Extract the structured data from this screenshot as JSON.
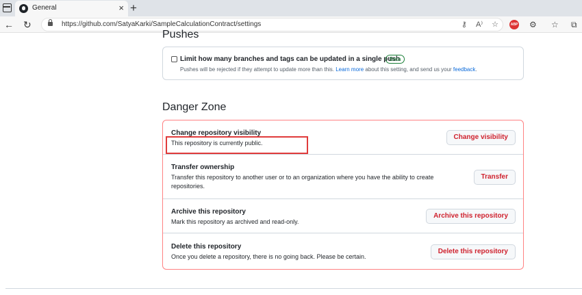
{
  "browser": {
    "tab_title": "General",
    "tab_close": "×",
    "new_tab": "+",
    "back": "←",
    "refresh": "↻",
    "url": "https://github.com/SatyaKarki/SampleCalculationContract/settings",
    "url_icons": [
      "key-icon",
      "read-aloud-icon",
      "favorite-add-icon"
    ],
    "url_icon_glyphs": [
      "⚷",
      "A⁾",
      "☆"
    ],
    "abp_label": "ABP",
    "toolbar_glyphs": [
      "⚙",
      "☆",
      "⧉"
    ]
  },
  "pushes": {
    "section_title": "Pushes",
    "label": "Limit how many branches and tags can be updated in a single push",
    "badge": "Beta",
    "desc_before": "Pushes will be rejected if they attempt to update more than this. ",
    "learn_more": "Learn more",
    "desc_middle": " about this setting, and send us your ",
    "feedback": "feedback",
    "desc_end": "."
  },
  "danger_zone": {
    "title": "Danger Zone",
    "rows": [
      {
        "title": "Change repository visibility",
        "desc": "This repository is currently public.",
        "button": "Change visibility"
      },
      {
        "title": "Transfer ownership",
        "desc": "Transfer this repository to another user or to an organization where you have the ability to create repositories.",
        "button": "Transfer"
      },
      {
        "title": "Archive this repository",
        "desc": "Mark this repository as archived and read-only.",
        "button": "Archive this repository"
      },
      {
        "title": "Delete this repository",
        "desc": "Once you delete a repository, there is no going back. Please be certain.",
        "button": "Delete this repository"
      }
    ]
  },
  "colors": {
    "danger": "#cf222e",
    "danger_border": "#ff8182",
    "link": "#0969da",
    "beta": "#1a7f37",
    "highlight": "#e03a3a"
  }
}
